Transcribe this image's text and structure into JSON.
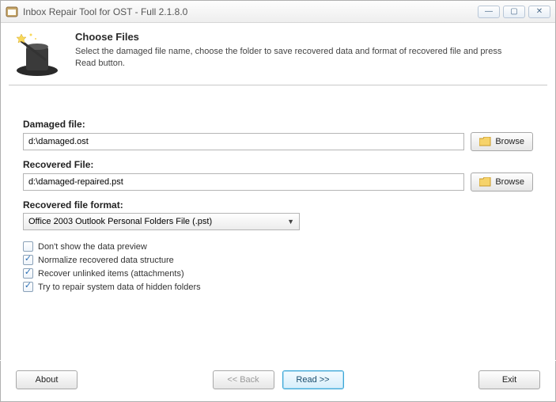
{
  "window": {
    "title": "Inbox Repair Tool for OST - Full 2.1.8.0"
  },
  "header": {
    "title": "Choose Files",
    "desc": "Select the damaged file name, choose the folder to save recovered data and format of recovered file and press Read button."
  },
  "fields": {
    "damaged_label": "Damaged file:",
    "damaged_value": "d:\\damaged.ost",
    "recovered_label": "Recovered File:",
    "recovered_value": "d:\\damaged-repaired.pst",
    "format_label": "Recovered file format:",
    "format_value": "Office 2003 Outlook Personal Folders File (.pst)",
    "browse_label": "Browse"
  },
  "options": {
    "opt1": {
      "label": "Don't show the data preview",
      "checked": false
    },
    "opt2": {
      "label": "Normalize recovered data structure",
      "checked": true
    },
    "opt3": {
      "label": "Recover unlinked items (attachments)",
      "checked": true
    },
    "opt4": {
      "label": "Try to repair system data of hidden folders",
      "checked": true
    }
  },
  "buttons": {
    "about": "About",
    "back": "<< Back",
    "read": "Read >>",
    "exit": "Exit"
  }
}
